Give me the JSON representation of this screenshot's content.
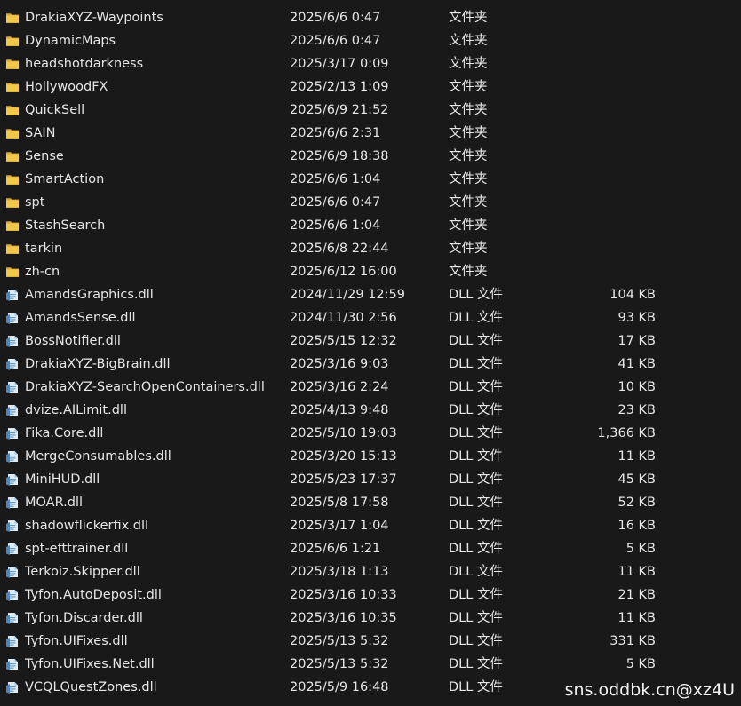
{
  "files": [
    {
      "name": "DrakiaXYZ-Waypoints",
      "date": "2025/6/6 0:47",
      "type": "文件夹",
      "size": "",
      "icon": "folder-icon"
    },
    {
      "name": "DynamicMaps",
      "date": "2025/6/6 0:47",
      "type": "文件夹",
      "size": "",
      "icon": "folder-icon"
    },
    {
      "name": "headshotdarkness",
      "date": "2025/3/17 0:09",
      "type": "文件夹",
      "size": "",
      "icon": "folder-icon"
    },
    {
      "name": "HollywoodFX",
      "date": "2025/2/13 1:09",
      "type": "文件夹",
      "size": "",
      "icon": "folder-icon"
    },
    {
      "name": "QuickSell",
      "date": "2025/6/9 21:52",
      "type": "文件夹",
      "size": "",
      "icon": "folder-icon"
    },
    {
      "name": "SAIN",
      "date": "2025/6/6 2:31",
      "type": "文件夹",
      "size": "",
      "icon": "folder-icon"
    },
    {
      "name": "Sense",
      "date": "2025/6/9 18:38",
      "type": "文件夹",
      "size": "",
      "icon": "folder-icon"
    },
    {
      "name": "SmartAction",
      "date": "2025/6/6 1:04",
      "type": "文件夹",
      "size": "",
      "icon": "folder-icon"
    },
    {
      "name": "spt",
      "date": "2025/6/6 0:47",
      "type": "文件夹",
      "size": "",
      "icon": "folder-icon"
    },
    {
      "name": "StashSearch",
      "date": "2025/6/6 1:04",
      "type": "文件夹",
      "size": "",
      "icon": "folder-icon"
    },
    {
      "name": "tarkin",
      "date": "2025/6/8 22:44",
      "type": "文件夹",
      "size": "",
      "icon": "folder-icon"
    },
    {
      "name": "zh-cn",
      "date": "2025/6/12 16:00",
      "type": "文件夹",
      "size": "",
      "icon": "folder-icon"
    },
    {
      "name": "AmandsGraphics.dll",
      "date": "2024/11/29 12:59",
      "type": "DLL 文件",
      "size": "104 KB",
      "icon": "dll-file-icon"
    },
    {
      "name": "AmandsSense.dll",
      "date": "2024/11/30 2:56",
      "type": "DLL 文件",
      "size": "93 KB",
      "icon": "dll-file-icon"
    },
    {
      "name": "BossNotifier.dll",
      "date": "2025/5/15 12:32",
      "type": "DLL 文件",
      "size": "17 KB",
      "icon": "dll-file-icon"
    },
    {
      "name": "DrakiaXYZ-BigBrain.dll",
      "date": "2025/3/16 9:03",
      "type": "DLL 文件",
      "size": "41 KB",
      "icon": "dll-file-icon"
    },
    {
      "name": "DrakiaXYZ-SearchOpenContainers.dll",
      "date": "2025/3/16 2:24",
      "type": "DLL 文件",
      "size": "10 KB",
      "icon": "dll-file-icon"
    },
    {
      "name": "dvize.AILimit.dll",
      "date": "2025/4/13 9:48",
      "type": "DLL 文件",
      "size": "23 KB",
      "icon": "dll-file-icon"
    },
    {
      "name": "Fika.Core.dll",
      "date": "2025/5/10 19:03",
      "type": "DLL 文件",
      "size": "1,366 KB",
      "icon": "dll-file-icon"
    },
    {
      "name": "MergeConsumables.dll",
      "date": "2025/3/20 15:13",
      "type": "DLL 文件",
      "size": "11 KB",
      "icon": "dll-file-icon"
    },
    {
      "name": "MiniHUD.dll",
      "date": "2025/5/23 17:37",
      "type": "DLL 文件",
      "size": "45 KB",
      "icon": "dll-file-icon"
    },
    {
      "name": "MOAR.dll",
      "date": "2025/5/8 17:58",
      "type": "DLL 文件",
      "size": "52 KB",
      "icon": "dll-file-icon"
    },
    {
      "name": "shadowflickerfix.dll",
      "date": "2025/3/17 1:04",
      "type": "DLL 文件",
      "size": "16 KB",
      "icon": "dll-file-icon"
    },
    {
      "name": "spt-efttrainer.dll",
      "date": "2025/6/6 1:21",
      "type": "DLL 文件",
      "size": "5 KB",
      "icon": "dll-file-icon"
    },
    {
      "name": "Terkoiz.Skipper.dll",
      "date": "2025/3/18 1:13",
      "type": "DLL 文件",
      "size": "11 KB",
      "icon": "dll-file-icon"
    },
    {
      "name": "Tyfon.AutoDeposit.dll",
      "date": "2025/3/16 10:33",
      "type": "DLL 文件",
      "size": "21 KB",
      "icon": "dll-file-icon"
    },
    {
      "name": "Tyfon.Discarder.dll",
      "date": "2025/3/16 10:35",
      "type": "DLL 文件",
      "size": "11 KB",
      "icon": "dll-file-icon"
    },
    {
      "name": "Tyfon.UIFixes.dll",
      "date": "2025/5/13 5:32",
      "type": "DLL 文件",
      "size": "331 KB",
      "icon": "dll-file-icon"
    },
    {
      "name": "Tyfon.UIFixes.Net.dll",
      "date": "2025/5/13 5:32",
      "type": "DLL 文件",
      "size": "5 KB",
      "icon": "dll-file-icon"
    },
    {
      "name": "VCQLQuestZones.dll",
      "date": "2025/5/9 16:48",
      "type": "DLL 文件",
      "size": "",
      "icon": "dll-file-icon"
    }
  ],
  "watermark": "sns.oddbk.cn@xz4U",
  "colors": {
    "background": "#191919",
    "text": "#e6e6e6",
    "folder": "#f2c84b",
    "dll": "#9fc7e6"
  }
}
